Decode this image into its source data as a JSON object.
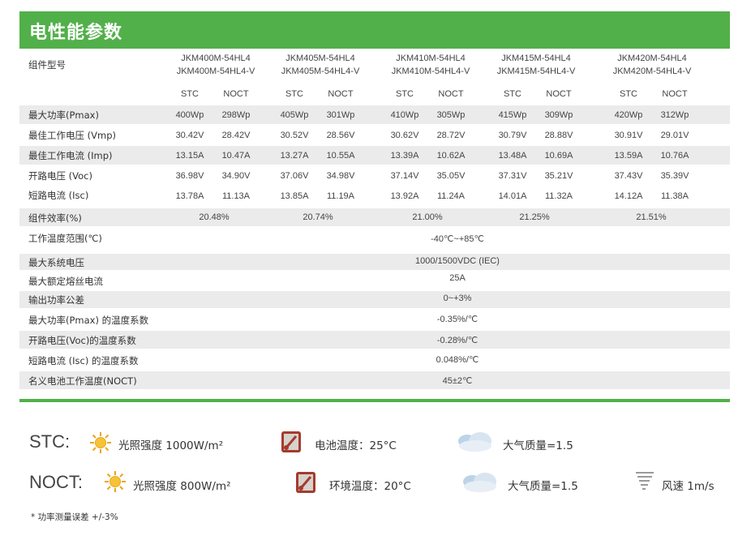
{
  "title": "电性能参数",
  "header": {
    "label": "组件型号",
    "models": [
      [
        "JKM400M-54HL4",
        "JKM400M-54HL4-V"
      ],
      [
        "JKM405M-54HL4",
        "JKM405M-54HL4-V"
      ],
      [
        "JKM410M-54HL4",
        "JKM410M-54HL4-V"
      ],
      [
        "JKM415M-54HL4",
        "JKM415M-54HL4-V"
      ],
      [
        "JKM420M-54HL4",
        "JKM420M-54HL4-V"
      ]
    ],
    "stc": "STC",
    "noct": "NOCT"
  },
  "rows": [
    {
      "label": "最大功率(Pmax)",
      "values": [
        "400Wp",
        "298Wp",
        "405Wp",
        "301Wp",
        "410Wp",
        "305Wp",
        "415Wp",
        "309Wp",
        "420Wp",
        "312Wp"
      ]
    },
    {
      "label": "最佳工作电压 (Vmp)",
      "values": [
        "30.42V",
        "28.42V",
        "30.52V",
        "28.56V",
        "30.62V",
        "28.72V",
        "30.79V",
        "28.88V",
        "30.91V",
        "29.01V"
      ]
    },
    {
      "label": "最佳工作电流 (Imp)",
      "values": [
        "13.15A",
        "10.47A",
        "13.27A",
        "10.55A",
        "13.39A",
        "10.62A",
        "13.48A",
        "10.69A",
        "13.59A",
        "10.76A"
      ]
    },
    {
      "label": "开路电压 (Voc)",
      "values": [
        "36.98V",
        "34.90V",
        "37.06V",
        "34.98V",
        "37.14V",
        "35.05V",
        "37.31V",
        "35.21V",
        "37.43V",
        "35.39V"
      ]
    },
    {
      "label": "短路电流 (Isc)",
      "values": [
        "13.78A",
        "11.13A",
        "13.85A",
        "11.19A",
        "13.92A",
        "11.24A",
        "14.01A",
        "11.32A",
        "14.12A",
        "11.38A"
      ]
    }
  ],
  "efficiency": {
    "label": "组件效率(%)",
    "values": [
      "20.48%",
      "20.74%",
      "21.00%",
      "21.25%",
      "21.51%"
    ]
  },
  "spans": [
    {
      "label": "工作温度范围(℃)",
      "value": "-40℃~+85℃"
    },
    {
      "label": "最大系统电压",
      "value": "1000/1500VDC (IEC)"
    },
    {
      "label": "最大额定熔丝电流",
      "value": "25A"
    },
    {
      "label": "输出功率公差",
      "value": "0~+3%"
    },
    {
      "label": "最大功率(Pmax) 的温度系数",
      "value": "-0.35%/℃"
    },
    {
      "label": "开路电压(Voc)的温度系数",
      "value": "-0.28%/℃"
    },
    {
      "label": "短路电流 (Isc) 的温度系数",
      "value": "0.048%/℃"
    },
    {
      "label": "名义电池工作温度(NOCT)",
      "value": "45±2℃"
    }
  ],
  "legend": {
    "stc": {
      "key": "STC:",
      "irradiance": "光照强度 1000W/m²",
      "temp": "电池温度：25°C",
      "am": "大气质量=1.5"
    },
    "noct": {
      "key": "NOCT:",
      "irradiance": "光照强度 800W/m²",
      "temp": "环境温度：20°C",
      "am": "大气质量=1.5",
      "wind": "风速 1m/s"
    }
  },
  "note": "* 功率测量误差 +/-3%",
  "colors": {
    "accent": "#52b04a",
    "row_shade": "#ebebeb"
  },
  "icons": [
    "sun-icon",
    "thermometer-icon",
    "cloud-icon",
    "tornado-icon"
  ]
}
